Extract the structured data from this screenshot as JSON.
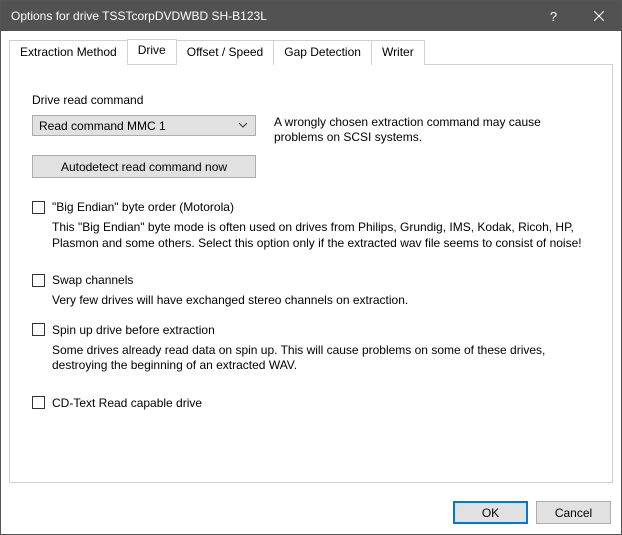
{
  "window": {
    "title": "Options for drive TSSTcorpDVDWBD SH-B123L"
  },
  "tabs": {
    "items": [
      {
        "label": "Extraction Method"
      },
      {
        "label": "Drive"
      },
      {
        "label": "Offset / Speed"
      },
      {
        "label": "Gap Detection"
      },
      {
        "label": "Writer"
      }
    ]
  },
  "drive_panel": {
    "section_label": "Drive read command",
    "dropdown_value": "Read command MMC 1",
    "hint": "A wrongly chosen extraction command may cause problems on SCSI systems.",
    "autodetect_label": "Autodetect read command now",
    "big_endian": {
      "label": "\"Big Endian\" byte order (Motorola)",
      "desc": "This \"Big Endian\" byte mode is often used on drives from Philips, Grundig, IMS, Kodak, Ricoh, HP, Plasmon and some others. Select this option only if the extracted wav file seems to consist of noise!"
    },
    "swap_channels": {
      "label": "Swap channels",
      "desc": "Very few drives will have exchanged stereo channels on extraction."
    },
    "spin_up": {
      "label": "Spin up drive before extraction",
      "desc": "Some drives already read data on spin up. This will cause problems on some of these drives, destroying the beginning of an extracted WAV."
    },
    "cd_text": {
      "label": "CD-Text Read capable drive"
    }
  },
  "footer": {
    "ok": "OK",
    "cancel": "Cancel"
  }
}
